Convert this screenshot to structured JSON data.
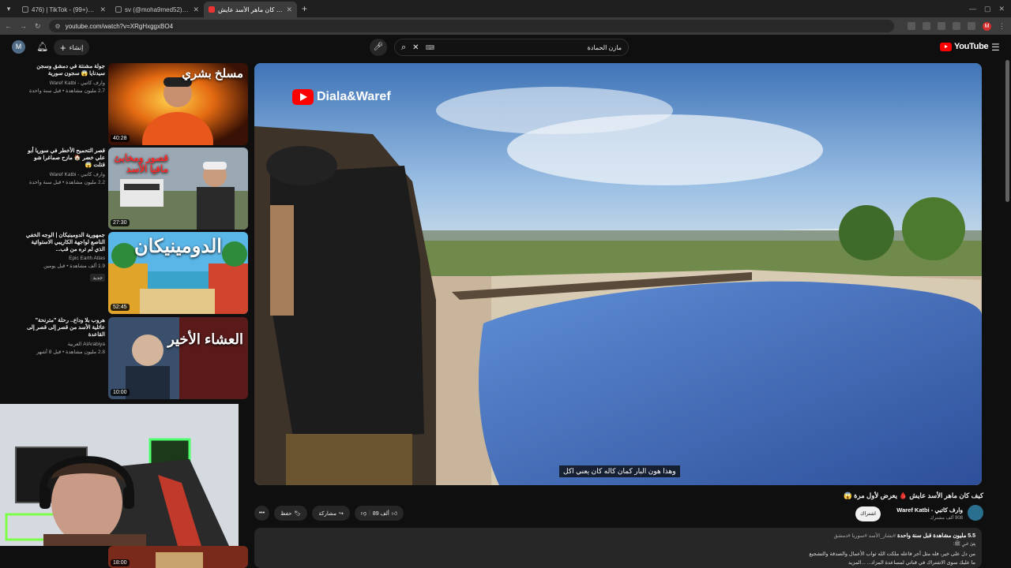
{
  "browser": {
    "tabs": [
      {
        "title": "476) | TikTok - (99+)وطن بيجي",
        "icon": "tiktok"
      },
      {
        "title": "sv (@moha9med52) | TikTok",
        "icon": "tiktok"
      },
      {
        "title": "كيف كان ماهر الأسد عايش!...",
        "icon": "youtube",
        "active": true
      }
    ],
    "url": "youtube.com/watch?v=XRgHxggxBO4"
  },
  "header": {
    "avatar_letter": "M",
    "create_label": "إنشاء",
    "search_query": "مازن الحمادة",
    "logo_text": "YouTube"
  },
  "sidebar": {
    "items": [
      {
        "title": "جولة مشنتة في دمشق وسجن سيدنايا 😱 سجون سورية",
        "channel": "وارف كاتبي - Waref Katbi",
        "views": "2.7 مليون مشاهدة • قبل سنة واحدة",
        "duration": "40:28",
        "overlay": "مسلخ بشري"
      },
      {
        "title": "قصر التحميح الأخطر في سوريا أبو علي خضر 🏠 مازح صماغرا شو قتلت 😱",
        "channel": "وارف كاتبي - Waref Katbi",
        "views": "2.2 مليون مشاهدة • قبل سنة واحدة",
        "duration": "27:30",
        "overlay": "قصور ومخابئ مافيا الأسد"
      },
      {
        "title": "جمهورية الدومينيكان | الوجه الخفي الناصع لواجهة الكاريبي الاستوائية الذي لم تره من قب...",
        "channel": "Epic Earth Atlas",
        "views": "1.9 ألف مشاهدة • قبل يومين",
        "badge": "جديد",
        "duration": "52:45",
        "overlay": "الدومينيكان"
      },
      {
        "title": "هروب بلا وداع.. رحلة \"مترنحة\" عائلية الأسد من قصر إلى قصر إلى القاعدة",
        "channel": "AlArabiya العربية",
        "views": "2.8 مليون مشاهدة • قبل 8 أشهر",
        "duration": "10:00",
        "overlay": "العشاء الأخير"
      },
      {
        "title": "",
        "channel": "",
        "views": "",
        "duration": "18:00",
        "overlay": ""
      }
    ]
  },
  "video": {
    "watermark": "Diala&Waref",
    "subtitle": "وهذا هون البار كمان كاله كان يعني اكل",
    "title": "كيف كان ماهر الأسد عايش 🩸 يعرض لأول مرة 😱",
    "channel_name": "وارف كاتبي - Waref Katbi",
    "subscribers": "908 ألف مشترك",
    "subscribe_label": "اشتراك",
    "likes": "89 ألف",
    "share_label": "مشاركة",
    "save_label": "حفظ",
    "more_label": "•••"
  },
  "description": {
    "stats": "5.5 مليون مشاهدة  قبل سنة واحدة",
    "tags": "#بشار_الأسد #سوريا #دمشق",
    "line1": "يقول النبي ﷺ:",
    "line2": "من دل على خير، فله مثل أجر فاعله ملكت الله ثواب الأعمال والصدقة والتشجيع",
    "line3": "ما عليك سوى الاشتراك في قناتي لمساعدة المزاد... ...المزيد"
  },
  "colors": {
    "bg": "#0f0f0f",
    "accent": "#ff0000",
    "chip": "#272727"
  }
}
